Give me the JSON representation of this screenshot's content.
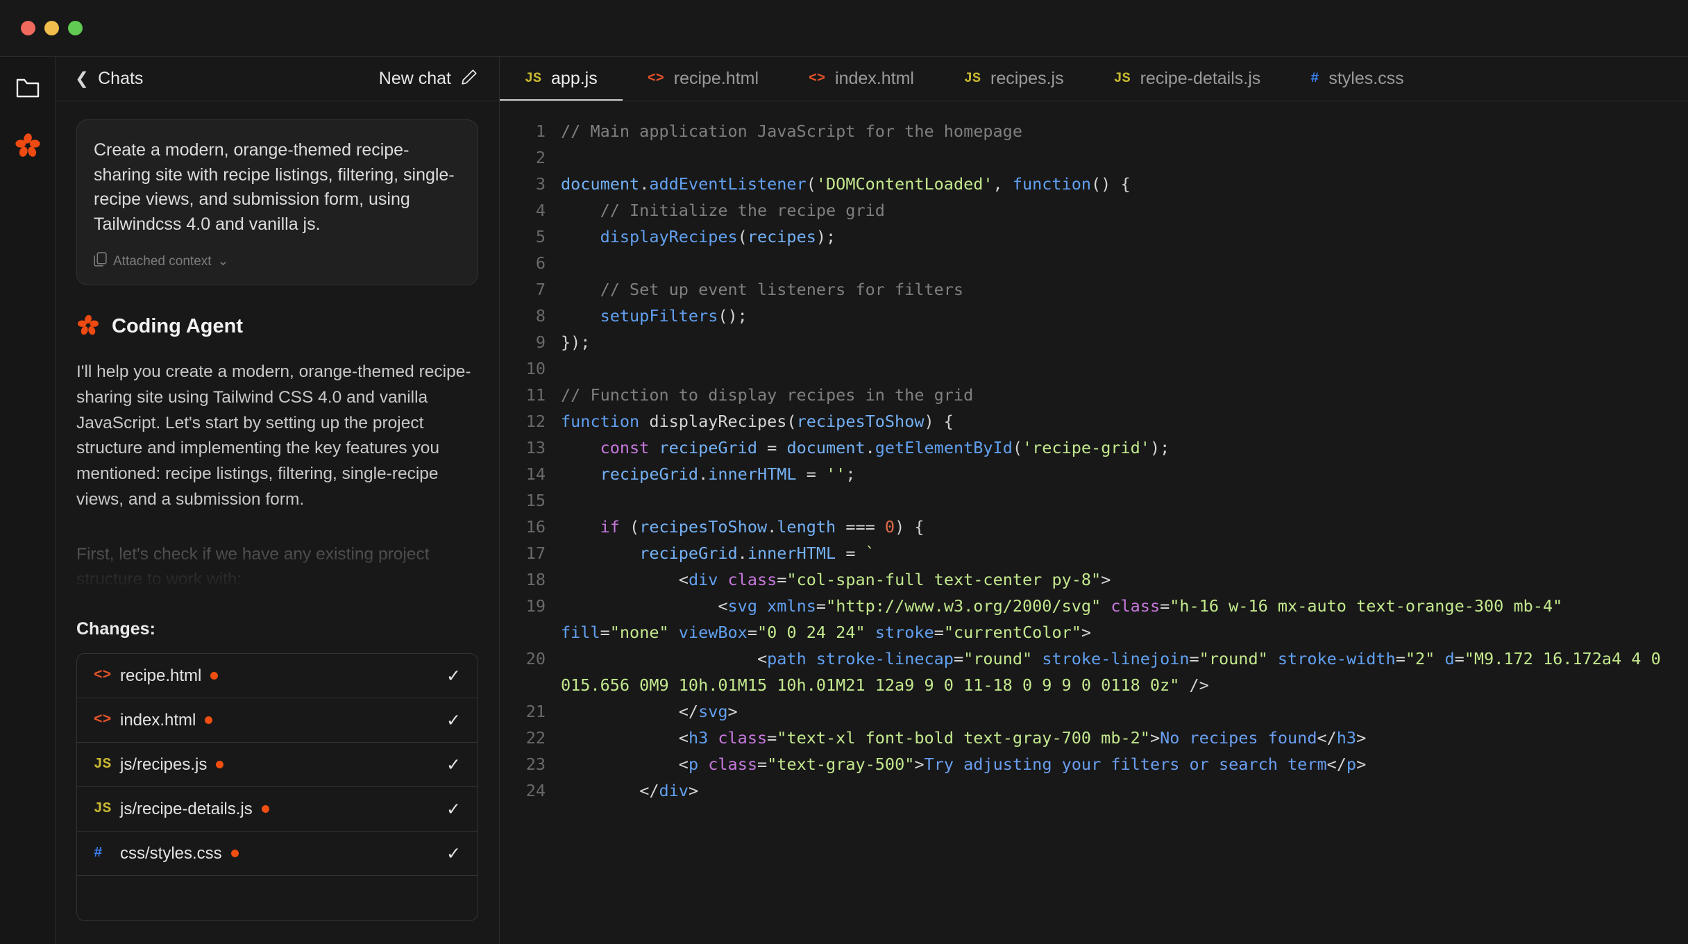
{
  "window": {
    "traffic_lights": [
      "close",
      "minimize",
      "maximize"
    ],
    "colors": {
      "close": "#f06a5e",
      "minimize": "#f2bd4d",
      "maximize": "#61ca52",
      "accent": "#f04d10",
      "background": "#181818"
    }
  },
  "rail": {
    "items": [
      {
        "name": "folder-icon",
        "label": "Files"
      },
      {
        "name": "agent-logo-icon",
        "label": "Coding Agent"
      }
    ]
  },
  "sidebar": {
    "back_label": "Chats",
    "back_icon": "chevron-left-icon",
    "new_chat_label": "New chat",
    "new_chat_icon": "pencil-icon",
    "prompt": {
      "text": "Create a modern, orange-themed recipe-sharing site with recipe listings, filtering, single-recipe views, and submission form, using Tailwindcss 4.0 and vanilla js.",
      "attached_label": "Attached context",
      "attached_icon": "copy-icon",
      "attached_chevron": "chevron-down-icon"
    },
    "agent": {
      "name": "Coding Agent",
      "avatar_icon": "flower-logo-icon",
      "message": "I'll help you create a modern, orange-themed recipe-sharing site using Tailwind CSS 4.0 and vanilla JavaScript. Let's start by setting up the project structure and implementing the key features you mentioned: recipe listings, filtering, single-recipe views, and a submission form.",
      "message_faded": "First, let's check if we have any existing project structure to work with:"
    },
    "changes": {
      "title": "Changes:",
      "files": [
        {
          "icon": "html-icon",
          "icon_glyph": "<>",
          "icon_kind": "html",
          "name": "recipe.html",
          "modified": true,
          "status_icon": "check-icon"
        },
        {
          "icon": "html-icon",
          "icon_glyph": "<>",
          "icon_kind": "html",
          "name": "index.html",
          "modified": true,
          "status_icon": "check-icon"
        },
        {
          "icon": "js-icon",
          "icon_glyph": "JS",
          "icon_kind": "js",
          "name": "js/recipes.js",
          "modified": true,
          "status_icon": "check-icon"
        },
        {
          "icon": "js-icon",
          "icon_glyph": "JS",
          "icon_kind": "js",
          "name": "js/recipe-details.js",
          "modified": true,
          "status_icon": "check-icon"
        },
        {
          "icon": "css-icon",
          "icon_glyph": "#",
          "icon_kind": "css",
          "name": "css/styles.css",
          "modified": true,
          "status_icon": "check-icon"
        },
        {
          "icon": "",
          "icon_glyph": "",
          "icon_kind": "",
          "name": "",
          "modified": false,
          "status_icon": ""
        }
      ]
    }
  },
  "editor": {
    "tabs": [
      {
        "label": "app.js",
        "icon_glyph": "JS",
        "icon_kind": "js",
        "active": true
      },
      {
        "label": "recipe.html",
        "icon_glyph": "<>",
        "icon_kind": "html",
        "active": false
      },
      {
        "label": "index.html",
        "icon_glyph": "<>",
        "icon_kind": "html",
        "active": false
      },
      {
        "label": "recipes.js",
        "icon_glyph": "JS",
        "icon_kind": "js",
        "active": false
      },
      {
        "label": "recipe-details.js",
        "icon_glyph": "JS",
        "icon_kind": "js",
        "active": false
      },
      {
        "label": "styles.css",
        "icon_glyph": "#",
        "icon_kind": "css",
        "active": false
      }
    ],
    "language": "javascript",
    "first_line": 1,
    "last_line": 24,
    "lines": [
      {
        "n": "1",
        "tokens": [
          {
            "t": "// Main application JavaScript for the homepage",
            "c": "c-com"
          }
        ]
      },
      {
        "n": "2",
        "tokens": []
      },
      {
        "n": "3",
        "tokens": [
          {
            "t": "document",
            "c": "c-var"
          },
          {
            "t": ".",
            "c": "c-pun"
          },
          {
            "t": "addEventListener",
            "c": "c-fn"
          },
          {
            "t": "(",
            "c": "c-pun"
          },
          {
            "t": "'DOMContentLoaded'",
            "c": "c-str"
          },
          {
            "t": ", ",
            "c": "c-pun"
          },
          {
            "t": "function",
            "c": "c-fn"
          },
          {
            "t": "() {",
            "c": "c-pun"
          }
        ]
      },
      {
        "n": "4",
        "tokens": [
          {
            "t": "    // Initialize the recipe grid",
            "c": "c-com"
          }
        ]
      },
      {
        "n": "5",
        "tokens": [
          {
            "t": "    ",
            "c": "c-pun"
          },
          {
            "t": "displayRecipes",
            "c": "c-fn"
          },
          {
            "t": "(",
            "c": "c-pun"
          },
          {
            "t": "recipes",
            "c": "c-var"
          },
          {
            "t": ");",
            "c": "c-pun"
          }
        ]
      },
      {
        "n": "6",
        "tokens": []
      },
      {
        "n": "7",
        "tokens": [
          {
            "t": "    // Set up event listeners for filters",
            "c": "c-com"
          }
        ]
      },
      {
        "n": "8",
        "tokens": [
          {
            "t": "    ",
            "c": "c-pun"
          },
          {
            "t": "setupFilters",
            "c": "c-fn"
          },
          {
            "t": "();",
            "c": "c-pun"
          }
        ]
      },
      {
        "n": "9",
        "tokens": [
          {
            "t": "});",
            "c": "c-pun"
          }
        ]
      },
      {
        "n": "10",
        "tokens": []
      },
      {
        "n": "11",
        "tokens": [
          {
            "t": "// Function to display recipes in the grid",
            "c": "c-com"
          }
        ]
      },
      {
        "n": "12",
        "tokens": [
          {
            "t": "function",
            "c": "c-fn"
          },
          {
            "t": " ",
            "c": "c-pun"
          },
          {
            "t": "displayRecipes",
            "c": "c-pun"
          },
          {
            "t": "(",
            "c": "c-pun"
          },
          {
            "t": "recipesToShow",
            "c": "c-var"
          },
          {
            "t": ") {",
            "c": "c-pun"
          }
        ]
      },
      {
        "n": "13",
        "tokens": [
          {
            "t": "    ",
            "c": "c-pun"
          },
          {
            "t": "const",
            "c": "c-kw"
          },
          {
            "t": " ",
            "c": "c-pun"
          },
          {
            "t": "recipeGrid",
            "c": "c-var"
          },
          {
            "t": " = ",
            "c": "c-pun"
          },
          {
            "t": "document",
            "c": "c-var"
          },
          {
            "t": ".",
            "c": "c-pun"
          },
          {
            "t": "getElementById",
            "c": "c-fn"
          },
          {
            "t": "(",
            "c": "c-pun"
          },
          {
            "t": "'recipe-grid'",
            "c": "c-str"
          },
          {
            "t": ");",
            "c": "c-pun"
          }
        ]
      },
      {
        "n": "14",
        "tokens": [
          {
            "t": "    ",
            "c": "c-pun"
          },
          {
            "t": "recipeGrid",
            "c": "c-var"
          },
          {
            "t": ".",
            "c": "c-pun"
          },
          {
            "t": "innerHTML",
            "c": "c-var"
          },
          {
            "t": " = ",
            "c": "c-pun"
          },
          {
            "t": "''",
            "c": "c-str"
          },
          {
            "t": ";",
            "c": "c-pun"
          }
        ]
      },
      {
        "n": "15",
        "tokens": []
      },
      {
        "n": "16",
        "tokens": [
          {
            "t": "    ",
            "c": "c-pun"
          },
          {
            "t": "if",
            "c": "c-kw"
          },
          {
            "t": " (",
            "c": "c-pun"
          },
          {
            "t": "recipesToShow",
            "c": "c-var"
          },
          {
            "t": ".",
            "c": "c-pun"
          },
          {
            "t": "length",
            "c": "c-var"
          },
          {
            "t": " === ",
            "c": "c-pun"
          },
          {
            "t": "0",
            "c": "c-num"
          },
          {
            "t": ") {",
            "c": "c-pun"
          }
        ]
      },
      {
        "n": "17",
        "tokens": [
          {
            "t": "        ",
            "c": "c-pun"
          },
          {
            "t": "recipeGrid",
            "c": "c-var"
          },
          {
            "t": ".",
            "c": "c-pun"
          },
          {
            "t": "innerHTML",
            "c": "c-var"
          },
          {
            "t": " = ",
            "c": "c-pun"
          },
          {
            "t": "`",
            "c": "c-str"
          }
        ]
      },
      {
        "n": "18",
        "tokens": [
          {
            "t": "            <",
            "c": "c-pun"
          },
          {
            "t": "div",
            "c": "c-tag"
          },
          {
            "t": " ",
            "c": "c-pun"
          },
          {
            "t": "class",
            "c": "c-attr"
          },
          {
            "t": "=",
            "c": "c-pun"
          },
          {
            "t": "\"col-span-full text-center py-8\"",
            "c": "c-str"
          },
          {
            "t": ">",
            "c": "c-pun"
          }
        ]
      },
      {
        "n": "19",
        "tokens": [
          {
            "t": "                <",
            "c": "c-pun"
          },
          {
            "t": "svg",
            "c": "c-tag"
          },
          {
            "t": " ",
            "c": "c-pun"
          },
          {
            "t": "xmlns",
            "c": "c-attrb"
          },
          {
            "t": "=",
            "c": "c-pun"
          },
          {
            "t": "\"http://www.w3.org/2000/svg\"",
            "c": "c-str"
          },
          {
            "t": " ",
            "c": "c-pun"
          },
          {
            "t": "class",
            "c": "c-attr"
          },
          {
            "t": "=",
            "c": "c-pun"
          },
          {
            "t": "\"h-16 w-16 mx-auto text-orange-300 mb-4\"",
            "c": "c-str"
          },
          {
            "t": " ",
            "c": "c-pun"
          },
          {
            "t": "fill",
            "c": "c-attrb"
          },
          {
            "t": "=",
            "c": "c-pun"
          },
          {
            "t": "\"none\"",
            "c": "c-str"
          },
          {
            "t": " ",
            "c": "c-pun"
          },
          {
            "t": "viewBox",
            "c": "c-attrb"
          },
          {
            "t": "=",
            "c": "c-pun"
          },
          {
            "t": "\"0 0 24 24\"",
            "c": "c-str"
          },
          {
            "t": " ",
            "c": "c-pun"
          },
          {
            "t": "stroke",
            "c": "c-attrb"
          },
          {
            "t": "=",
            "c": "c-pun"
          },
          {
            "t": "\"currentColor\"",
            "c": "c-str"
          },
          {
            "t": ">",
            "c": "c-pun"
          }
        ]
      },
      {
        "n": "20",
        "tokens": [
          {
            "t": "                    <",
            "c": "c-pun"
          },
          {
            "t": "path",
            "c": "c-tag"
          },
          {
            "t": " ",
            "c": "c-pun"
          },
          {
            "t": "stroke-linecap",
            "c": "c-attrb"
          },
          {
            "t": "=",
            "c": "c-pun"
          },
          {
            "t": "\"round\"",
            "c": "c-str"
          },
          {
            "t": " ",
            "c": "c-pun"
          },
          {
            "t": "stroke-linejoin",
            "c": "c-attrb"
          },
          {
            "t": "=",
            "c": "c-pun"
          },
          {
            "t": "\"round\"",
            "c": "c-str"
          },
          {
            "t": " ",
            "c": "c-pun"
          },
          {
            "t": "stroke-width",
            "c": "c-attrb"
          },
          {
            "t": "=",
            "c": "c-pun"
          },
          {
            "t": "\"2\"",
            "c": "c-str"
          },
          {
            "t": " ",
            "c": "c-pun"
          },
          {
            "t": "d",
            "c": "c-attrb"
          },
          {
            "t": "=",
            "c": "c-pun"
          },
          {
            "t": "\"M9.172 16.172a4 4 0 015.656 0M9 10h.01M15 10h.01M21 12a9 9 0 11-18 0 9 9 0 0118 0z\"",
            "c": "c-str"
          },
          {
            "t": " />",
            "c": "c-pun"
          }
        ]
      },
      {
        "n": "21",
        "tokens": [
          {
            "t": "            </",
            "c": "c-pun"
          },
          {
            "t": "svg",
            "c": "c-tag"
          },
          {
            "t": ">",
            "c": "c-pun"
          }
        ]
      },
      {
        "n": "22",
        "tokens": [
          {
            "t": "            <",
            "c": "c-pun"
          },
          {
            "t": "h3",
            "c": "c-tag"
          },
          {
            "t": " ",
            "c": "c-pun"
          },
          {
            "t": "class",
            "c": "c-attr"
          },
          {
            "t": "=",
            "c": "c-pun"
          },
          {
            "t": "\"text-xl font-bold text-gray-700 mb-2\"",
            "c": "c-str"
          },
          {
            "t": ">",
            "c": "c-pun"
          },
          {
            "t": "No recipes found",
            "c": "c-txt"
          },
          {
            "t": "</",
            "c": "c-pun"
          },
          {
            "t": "h3",
            "c": "c-tag"
          },
          {
            "t": ">",
            "c": "c-pun"
          }
        ]
      },
      {
        "n": "23",
        "tokens": [
          {
            "t": "            <",
            "c": "c-pun"
          },
          {
            "t": "p",
            "c": "c-tag"
          },
          {
            "t": " ",
            "c": "c-pun"
          },
          {
            "t": "class",
            "c": "c-attr"
          },
          {
            "t": "=",
            "c": "c-pun"
          },
          {
            "t": "\"text-gray-500\"",
            "c": "c-str"
          },
          {
            "t": ">",
            "c": "c-pun"
          },
          {
            "t": "Try adjusting your filters or search term",
            "c": "c-txt"
          },
          {
            "t": "</",
            "c": "c-pun"
          },
          {
            "t": "p",
            "c": "c-tag"
          },
          {
            "t": ">",
            "c": "c-pun"
          }
        ]
      },
      {
        "n": "24",
        "tokens": [
          {
            "t": "        </",
            "c": "c-pun"
          },
          {
            "t": "div",
            "c": "c-tag"
          },
          {
            "t": ">",
            "c": "c-pun"
          }
        ]
      }
    ]
  }
}
